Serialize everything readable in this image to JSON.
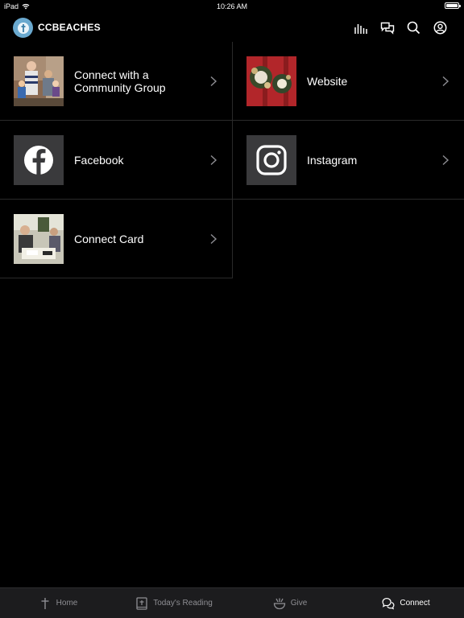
{
  "status_bar": {
    "device": "iPad",
    "time": "10:26 AM",
    "battery_level": 1.0
  },
  "header": {
    "title": "CCBEACHES",
    "icons": [
      "bars-chart-icon",
      "chat-icon",
      "search-icon",
      "profile-icon"
    ]
  },
  "tiles": [
    {
      "label": "Connect with a\nCommunity Group",
      "thumb": "community-group-photo"
    },
    {
      "label": "Website",
      "thumb": "website-photo"
    },
    {
      "label": "Facebook",
      "thumb": "facebook-icon"
    },
    {
      "label": "Instagram",
      "thumb": "instagram-icon"
    },
    {
      "label": "Connect Card",
      "thumb": "connect-card-photo"
    }
  ],
  "tabs": [
    {
      "label": "Home",
      "icon": "cross-icon",
      "active": false
    },
    {
      "label": "Today's Reading",
      "icon": "bible-icon",
      "active": false
    },
    {
      "label": "Give",
      "icon": "give-icon",
      "active": false
    },
    {
      "label": "Connect",
      "icon": "chat-bubbles-icon",
      "active": true
    }
  ],
  "colors": {
    "background": "#000000",
    "logo": "#6aa9cf",
    "tab_bar": "#1c1c1e",
    "inactive": "#8e8e93",
    "divider": "#2a2a2a"
  }
}
